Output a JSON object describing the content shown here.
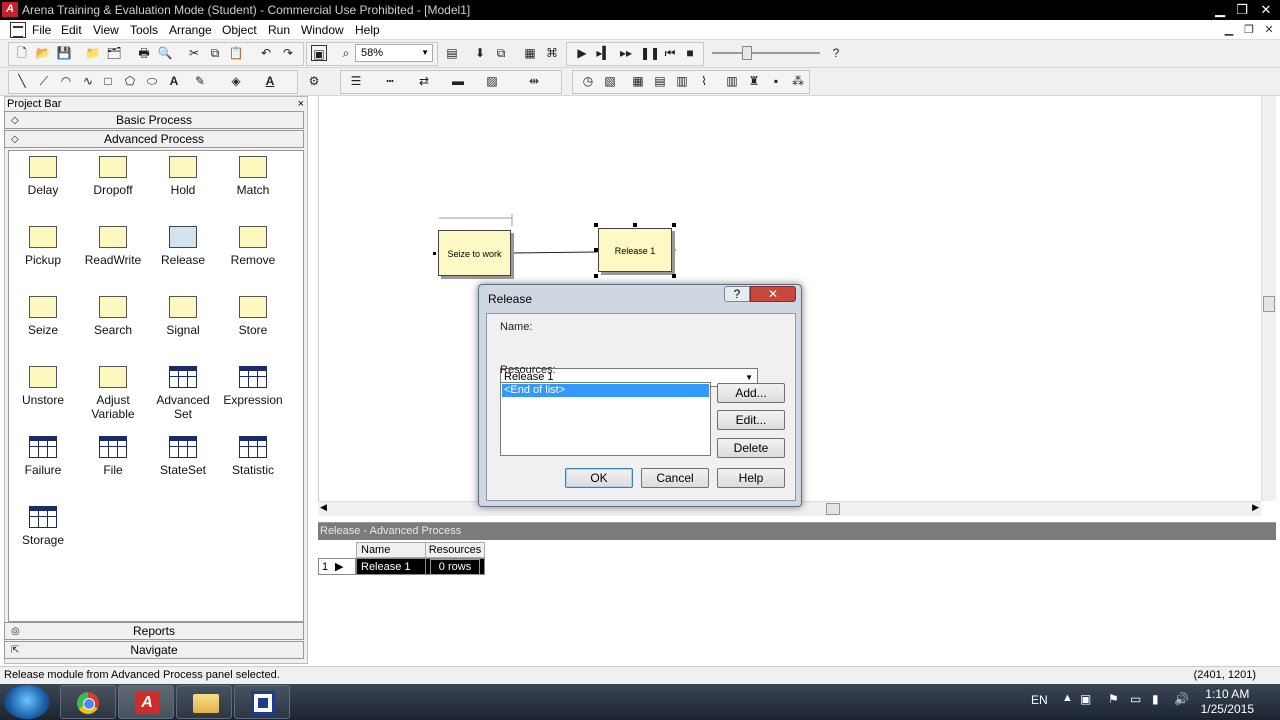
{
  "window": {
    "title": "Arena Training & Evaluation Mode (Student) - Commercial Use Prohibited - [Model1]",
    "logo": "A"
  },
  "menu": [
    "File",
    "Edit",
    "View",
    "Tools",
    "Arrange",
    "Object",
    "Run",
    "Window",
    "Help"
  ],
  "toolbar": {
    "zoom_value": "58%"
  },
  "project_bar": {
    "title": "Project Bar",
    "close": "×",
    "panels": [
      "Basic Process",
      "Advanced Process"
    ],
    "bottom_panels": [
      "Reports",
      "Navigate"
    ],
    "modules": [
      {
        "label": "Delay",
        "icon": "process"
      },
      {
        "label": "Dropoff",
        "icon": "process"
      },
      {
        "label": "Hold",
        "icon": "process"
      },
      {
        "label": "Match",
        "icon": "process"
      },
      {
        "label": "Pickup",
        "icon": "process"
      },
      {
        "label": "ReadWrite",
        "icon": "process"
      },
      {
        "label": "Release",
        "icon": "selected"
      },
      {
        "label": "Remove",
        "icon": "process"
      },
      {
        "label": "Seize",
        "icon": "process"
      },
      {
        "label": "Search",
        "icon": "process"
      },
      {
        "label": "Signal",
        "icon": "process"
      },
      {
        "label": "Store",
        "icon": "process"
      },
      {
        "label": "Unstore",
        "icon": "process"
      },
      {
        "label": "Adjust Variable",
        "icon": "process"
      },
      {
        "label": "Advanced Set",
        "icon": "table"
      },
      {
        "label": "Expression",
        "icon": "table"
      },
      {
        "label": "Failure",
        "icon": "table"
      },
      {
        "label": "File",
        "icon": "table"
      },
      {
        "label": "StateSet",
        "icon": "table"
      },
      {
        "label": "Statistic",
        "icon": "table"
      },
      {
        "label": "Storage",
        "icon": "table"
      }
    ]
  },
  "canvas": {
    "seize_label": "Seize to work",
    "release_label": "Release 1"
  },
  "dialog": {
    "title": "Release",
    "help": "?",
    "close": "✕",
    "name_label": "Name:",
    "name_value": "Release 1",
    "resources_label": "Resources:",
    "resources_items": [
      "<End of list>"
    ],
    "add": "Add...",
    "edit": "Edit...",
    "delete": "Delete",
    "ok": "OK",
    "cancel": "Cancel",
    "help_button": "Help"
  },
  "spreadsheet": {
    "title": "Release - Advanced Process",
    "col_name": "Name",
    "col_resources": "Resources",
    "row_number": "1",
    "row_name": "Release 1",
    "row_resources": "0 rows"
  },
  "status": {
    "message": "Release module from Advanced Process panel selected.",
    "coords": "(2401, 1201)"
  },
  "taskbar": {
    "language": "EN",
    "time": "1:10 AM",
    "date": "1/25/2015"
  }
}
